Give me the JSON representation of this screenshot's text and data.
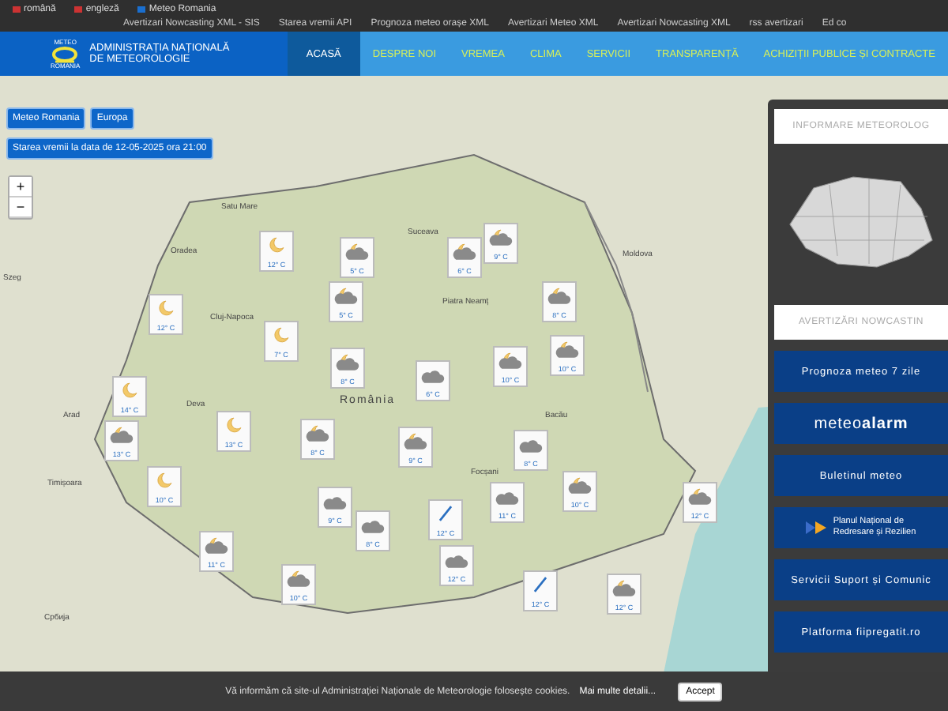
{
  "top_bar": {
    "languages": [
      {
        "label": "română"
      },
      {
        "label": "engleză"
      },
      {
        "label": "Meteo Romania"
      }
    ],
    "links": [
      {
        "label": "Avertizari Nowcasting XML - SIS"
      },
      {
        "label": "Starea vremii API"
      },
      {
        "label": "Prognoza meteo orașe XML"
      },
      {
        "label": "Avertizari Meteo XML"
      },
      {
        "label": "Avertizari Nowcasting XML"
      },
      {
        "label": "rss avertizari"
      },
      {
        "label": "Ed co"
      }
    ]
  },
  "header": {
    "logo_top": "METEO",
    "logo_bottom": "ROMANIA",
    "title_lines": [
      "ADMINISTRAȚIA NAȚIONALĂ",
      "DE METEOROLOGIE"
    ],
    "nav": [
      {
        "label": "ACASĂ",
        "selected": true
      },
      {
        "label": "DESPRE NOI",
        "selected": false
      },
      {
        "label": "VREMEA",
        "selected": false
      },
      {
        "label": "CLIMA",
        "selected": false
      },
      {
        "label": "SERVICII",
        "selected": false
      },
      {
        "label": "TRANSPARENȚĂ",
        "selected": false
      },
      {
        "label": "ACHIZIȚII PUBLICE ȘI CONTRACTE",
        "selected": false
      }
    ]
  },
  "map": {
    "buttons": [
      {
        "label": "Meteo Romania"
      },
      {
        "label": "Europa"
      }
    ],
    "date_badge": "Starea vremii la data de 12-05-2025 ora 21:00",
    "zoom": [
      "+",
      "−"
    ],
    "places": [
      "Satu Mare",
      "Oradea",
      "Cluj-Napoca",
      "Arad",
      "Timișoara",
      "Deva",
      "Suceava",
      "Piatra Neamț",
      "Bacău",
      "Moldova",
      "România",
      "Focșani",
      "Szeg",
      "Србија"
    ],
    "markers": [
      {
        "kind": "moon",
        "temp": "12° C"
      },
      {
        "kind": "cloud-moon",
        "temp": "5° C"
      },
      {
        "kind": "cloud-moon",
        "temp": "6° C"
      },
      {
        "kind": "cloud-moon",
        "temp": "9° C"
      },
      {
        "kind": "moon",
        "temp": "12° C"
      },
      {
        "kind": "cloud-moon",
        "temp": "5° C"
      },
      {
        "kind": "cloud-moon",
        "temp": "8° C"
      },
      {
        "kind": "moon",
        "temp": "7° C"
      },
      {
        "kind": "cloud-moon",
        "temp": "8° C"
      },
      {
        "kind": "cloud",
        "temp": "6° C"
      },
      {
        "kind": "cloud-moon",
        "temp": "10° C"
      },
      {
        "kind": "cloud-moon",
        "temp": "10° C"
      },
      {
        "kind": "moon",
        "temp": "14° C"
      },
      {
        "kind": "cloud-moon",
        "temp": "13° C"
      },
      {
        "kind": "moon",
        "temp": "13° C"
      },
      {
        "kind": "cloud-moon",
        "temp": "8° C"
      },
      {
        "kind": "cloud-moon",
        "temp": "9° C"
      },
      {
        "kind": "cloud",
        "temp": "8° C"
      },
      {
        "kind": "moon",
        "temp": "10° C"
      },
      {
        "kind": "cloud",
        "temp": "9° C"
      },
      {
        "kind": "cloud",
        "temp": "8° C"
      },
      {
        "kind": "rain",
        "temp": "12° C"
      },
      {
        "kind": "cloud",
        "temp": "11° C"
      },
      {
        "kind": "cloud-moon",
        "temp": "10° C"
      },
      {
        "kind": "cloud-moon",
        "temp": "12° C"
      },
      {
        "kind": "cloud-moon",
        "temp": "11° C"
      },
      {
        "kind": "cloud-moon",
        "temp": "10° C"
      },
      {
        "kind": "cloud",
        "temp": "12° C"
      },
      {
        "kind": "rain",
        "temp": "12° C"
      },
      {
        "kind": "cloud-moon",
        "temp": "12° C"
      }
    ]
  },
  "side_panel": {
    "info_title": "INFORMARE METEOROLOG",
    "warnings_title": "AVERTIZĂRI NOWCASTIN",
    "items": [
      {
        "kind": "text",
        "label": "Prognoza meteo 7 zile"
      },
      {
        "kind": "meteoalarm",
        "label": "meteo**alarm**"
      },
      {
        "kind": "text",
        "label": "Buletinul meteo"
      },
      {
        "kind": "pnrr",
        "label": "Planul Național de Redresare și Rezilien"
      },
      {
        "kind": "text",
        "label": "Servicii Suport și Comunic"
      },
      {
        "kind": "text",
        "label": "Platforma fiipregatit.ro"
      }
    ]
  },
  "cookie_bar": {
    "text": "Vă informăm că site-ul Administrației Naționale de Meteorologie folosește cookies.",
    "link": "Mai multe detalii...",
    "button": "Accept"
  }
}
